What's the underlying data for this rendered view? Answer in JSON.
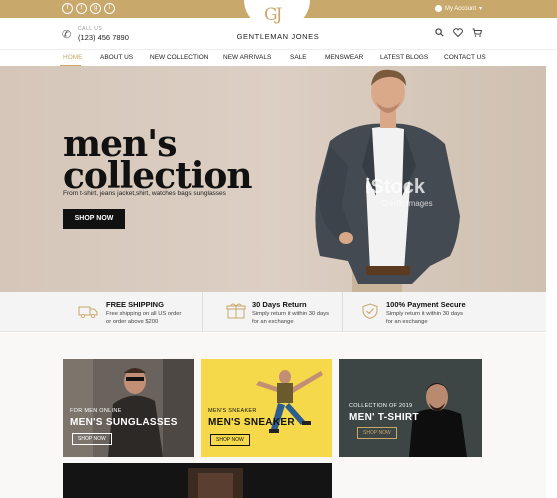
{
  "topbar": {
    "social": [
      "f",
      "t",
      "g",
      "i"
    ],
    "account_label": "My Account",
    "logo_mark": "GJ"
  },
  "header": {
    "call_label": "CALL US",
    "phone": "(123) 456 7890",
    "brand": "GENTLEMAN JONES",
    "icons": [
      "search-icon",
      "heart-icon",
      "cart-icon"
    ]
  },
  "nav": {
    "items": [
      "HOME",
      "ABOUT US",
      "NEW COLLECTION",
      "NEW ARRIVALS",
      "SALE",
      "MENSWEAR",
      "LATEST BLOGS",
      "CONTACT US"
    ],
    "active": "HOME"
  },
  "hero": {
    "title_line1": "men's",
    "title_line2": "collection",
    "subtitle": "From t-shirt, jeans jacket,shirt, watches bags sunglasses",
    "button": "SHOP NOW",
    "watermark": "iStock",
    "watermark_sub": "Credit: images"
  },
  "features": [
    {
      "title": "FREE SHIPPING",
      "desc": "Free shipping on all US order or order above $200",
      "icon": "truck-icon"
    },
    {
      "title": "30 Days Return",
      "desc": "Simply return it within 30 days for an exchange",
      "icon": "gift-icon"
    },
    {
      "title": "100% Payment Secure",
      "desc": "Simply return it within 30 days for an exchange",
      "icon": "shield-icon"
    }
  ],
  "tiles": [
    {
      "small": "FOR MEN ONLINE",
      "big": "MEN'S SUNGLASSES",
      "button": "SHOP NOW"
    },
    {
      "small": "MEN'S SNEAKER",
      "big": "MEN'S SNEAKER",
      "button": "SHOP NOW"
    },
    {
      "small": "COLLECTION OF 2019",
      "big": "MEN' T-SHIRT",
      "button": "SHOP NOW"
    }
  ],
  "colors": {
    "accent": "#c9a86b",
    "dark": "#111111",
    "yellow": "#f5d94a"
  }
}
